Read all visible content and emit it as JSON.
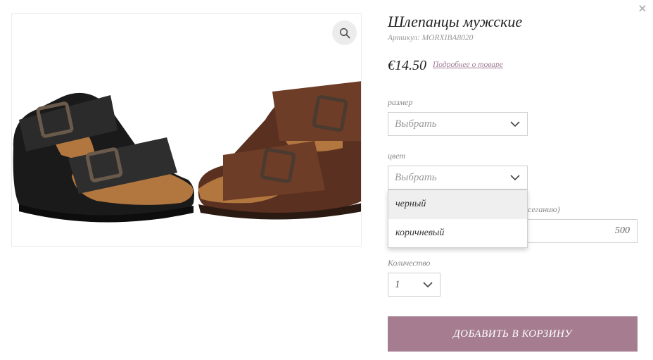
{
  "close_label": "×",
  "product": {
    "title": "Шлепанцы мужские",
    "sku_label": "Артикул: MORXIBA8020",
    "price": "€14.50",
    "details_link": "Подробнее о товаре"
  },
  "options": {
    "size": {
      "label": "размер",
      "value": "Выбрать"
    },
    "color": {
      "label": "цвет",
      "value": "Выбрать",
      "choices": [
        "черный",
        "коричневый"
      ],
      "highlighted_index": 0
    },
    "engraving": {
      "label_visible_fragment": "ксеганию)",
      "value": "500"
    },
    "quantity": {
      "label": "Количество",
      "value": "1"
    }
  },
  "add_to_cart_label": "ДОБАВИТЬ В КОРЗИНУ",
  "colors": {
    "accent": "#a67d90",
    "link": "#a07a93",
    "zoom_bg": "#ececec"
  }
}
